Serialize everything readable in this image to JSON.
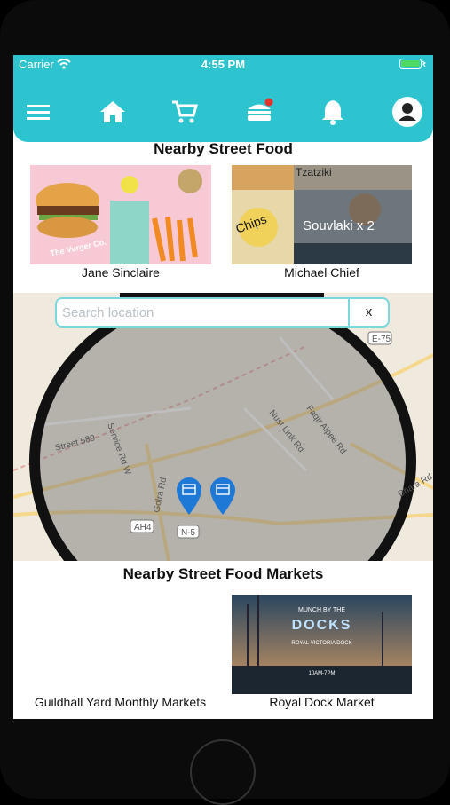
{
  "status_bar": {
    "carrier": "Carrier",
    "time": "4:55 PM"
  },
  "nav": {
    "icons": [
      "menu-icon",
      "home-icon",
      "cart-icon",
      "burger-icon",
      "bell-icon",
      "profile-icon"
    ]
  },
  "nearby_food": {
    "title": "Nearby Street Food",
    "cards": [
      {
        "name": "Jane Sinclaire",
        "image_text": "The Vurger Co."
      },
      {
        "name": "Michael Chief",
        "image_text": [
          "Tzatziki",
          "Chips",
          "Souvlaki x 2"
        ]
      }
    ]
  },
  "map": {
    "search_placeholder": "Search location",
    "clear_label": "x",
    "road_labels": [
      "E-75",
      "Faqir Aipee Rd",
      "Nust Link Rd",
      "Street 589",
      "Service Rd W",
      "Golra Rd",
      "AH4",
      "N-5",
      "Bhara Rd"
    ]
  },
  "markets": {
    "title": "Nearby Street Food Markets",
    "cards": [
      {
        "name": "Guildhall Yard Monthly Markets"
      },
      {
        "name": "Royal Dock Market",
        "image_text": [
          "MUNCH BY THE",
          "DOCKS",
          "ROYAL VICTORIA DOCK",
          "10AM-7PM"
        ]
      }
    ]
  },
  "colors": {
    "accent": "#2dc3cf",
    "marker": "#1e78d6"
  }
}
